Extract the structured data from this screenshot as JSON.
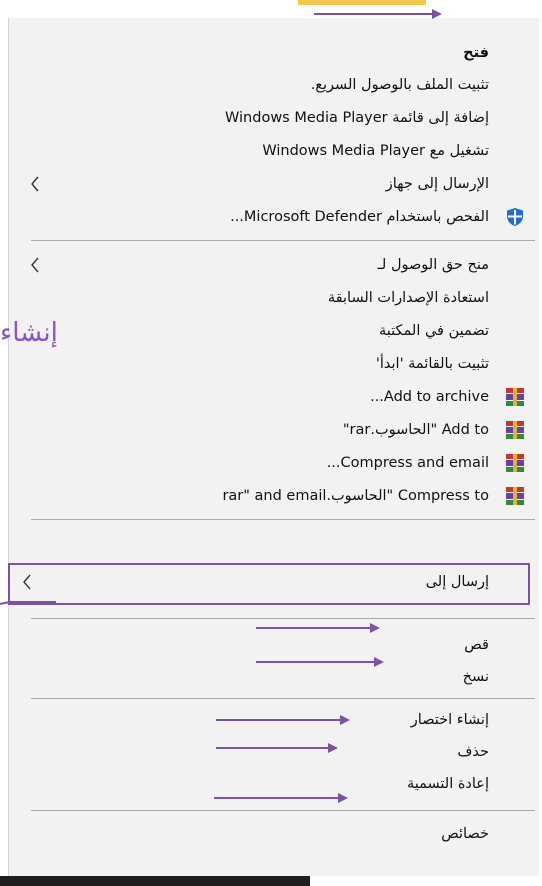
{
  "menu": {
    "items": [
      {
        "label": "فتح",
        "bold": true
      },
      {
        "label": "تثبيت الملف بالوصول السريع."
      },
      {
        "label": "إضافة إلى قائمة Windows Media Player"
      },
      {
        "label": "تشغيل مع Windows Media Player"
      },
      {
        "label": "الإرسال إلى جهاز",
        "submenu": true
      },
      {
        "label": "الفحص باستخدام Microsoft Defender...",
        "icon": "defender-shield-icon"
      },
      {
        "label": "منح حق الوصول لـ",
        "submenu": true
      },
      {
        "label": "استعادة الإصدارات السابقة"
      },
      {
        "label": "تضمين في المكتبة"
      },
      {
        "label": "تثبيت بالقائمة 'ابدأ'"
      },
      {
        "label": "Add to archive...",
        "icon": "winrar-icon"
      },
      {
        "label": "Add to \"الحاسوب.rar\"",
        "icon": "winrar-icon"
      },
      {
        "label": "Compress and email...",
        "icon": "winrar-icon"
      },
      {
        "label": "Compress to \"الحاسوب.rar\" and email",
        "icon": "winrar-icon"
      },
      {
        "label": "إرسال إلى",
        "submenu": true,
        "highlighted": true
      },
      {
        "label": "قص"
      },
      {
        "label": "نسخ"
      },
      {
        "label": "إنشاء اختصار"
      },
      {
        "label": "حذف"
      },
      {
        "label": "إعادة التسمية"
      },
      {
        "label": "خصائص"
      }
    ]
  },
  "annotation": {
    "side_text": "إنشاء",
    "color": "#7b52a6",
    "arrows_point_to": [
      "فتح",
      "قص",
      "نسخ",
      "إنشاء اختصار",
      "حذف",
      "إعادة التسمية"
    ]
  },
  "colors": {
    "menu_background": "#f2f2f2",
    "separator": "#a9a9a9",
    "defender_blue": "#1f6fd1"
  }
}
